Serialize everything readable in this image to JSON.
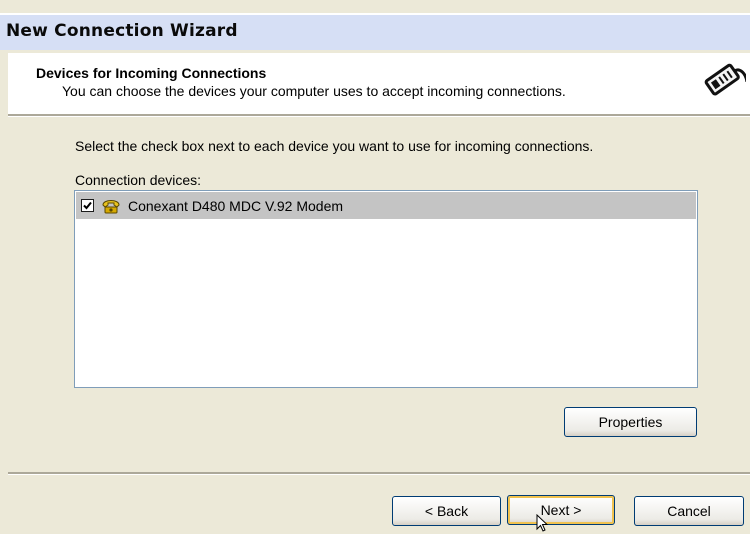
{
  "window": {
    "title": "New Connection Wizard"
  },
  "header": {
    "title": "Devices for Incoming Connections",
    "subtitle": "You can choose the devices your computer uses to accept incoming connections.",
    "icon": "wizard-connection-icon"
  },
  "body": {
    "instruction": "Select the check box next to each device you want to use for incoming connections.",
    "list_label": "Connection devices:",
    "devices": [
      {
        "label": "Conexant D480 MDC V.92 Modem",
        "checked": true,
        "selected": true,
        "icon": "modem-icon"
      }
    ],
    "properties_label": "Properties"
  },
  "footer": {
    "back_label": "< Back",
    "next_label": "Next >",
    "cancel_label": "Cancel"
  },
  "colors": {
    "dialog_bg": "#ece9d8",
    "selection": "#c4c4c4",
    "default_button_ring": "#f0c24f"
  }
}
